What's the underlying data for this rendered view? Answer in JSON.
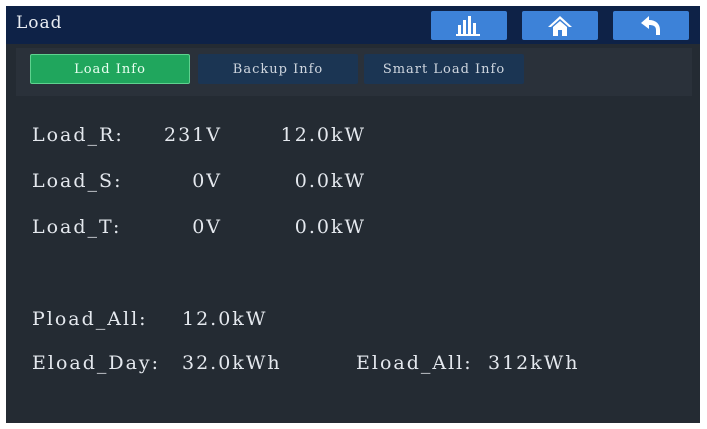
{
  "header": {
    "title": "Load",
    "buttons": [
      {
        "icon": "bar-chart-icon"
      },
      {
        "icon": "home-icon"
      },
      {
        "icon": "back-arrow-icon"
      }
    ]
  },
  "tabs": [
    {
      "label": "Load Info",
      "active": true
    },
    {
      "label": "Backup Info",
      "active": false
    },
    {
      "label": "Smart Load Info",
      "active": false
    }
  ],
  "phases": [
    {
      "label": "Load_R:",
      "voltage": "231V",
      "power": "12.0kW"
    },
    {
      "label": "Load_S:",
      "voltage": "0V",
      "power": "0.0kW"
    },
    {
      "label": "Load_T:",
      "voltage": "0V",
      "power": "0.0kW"
    }
  ],
  "totals": {
    "pload_all_label": "Pload_All:",
    "pload_all_value": "12.0kW",
    "eload_day_label": "Eload_Day:",
    "eload_day_value": "32.0kWh",
    "eload_all_label": "Eload_All:",
    "eload_all_value": "312kWh"
  },
  "colors": {
    "screen_bg": "#242b33",
    "header_bg": "#0e2247",
    "header_button": "#3d82d8",
    "tab_active": "#20a65d",
    "tab_inactive": "#1b3553",
    "text": "#e4e8ee"
  }
}
